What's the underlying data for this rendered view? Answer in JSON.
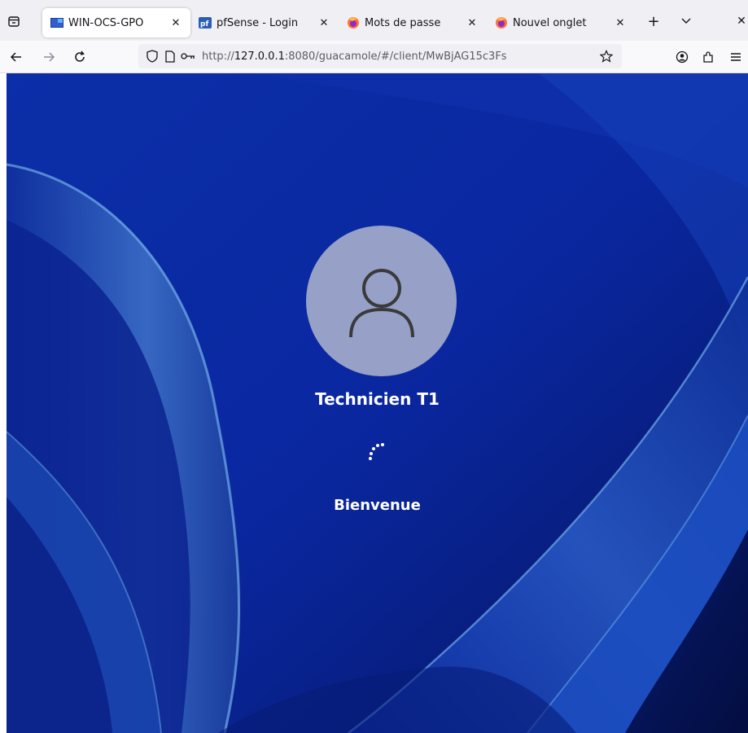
{
  "browser": {
    "tabs": [
      {
        "title": "WIN-OCS-GPO",
        "favicon": "remote-desktop-icon",
        "active": true
      },
      {
        "title": "pfSense - Login",
        "favicon": "pfsense-icon",
        "active": false
      },
      {
        "title": "Mots de passe",
        "favicon": "firefox-icon",
        "active": false
      },
      {
        "title": "Nouvel onglet",
        "favicon": "firefox-icon",
        "active": false
      }
    ],
    "url": {
      "scheme": "http://",
      "host": "127.0.0.1",
      "rest": ":8080/guacamole/#/client/MwBjAG15c3Fs"
    }
  },
  "session": {
    "user_name": "Technicien T1",
    "status": "Bienvenue"
  },
  "colors": {
    "wallpaper_blue": "#0a2a9c",
    "avatar_bg": "#97a1c8",
    "text": "#ffffff"
  }
}
